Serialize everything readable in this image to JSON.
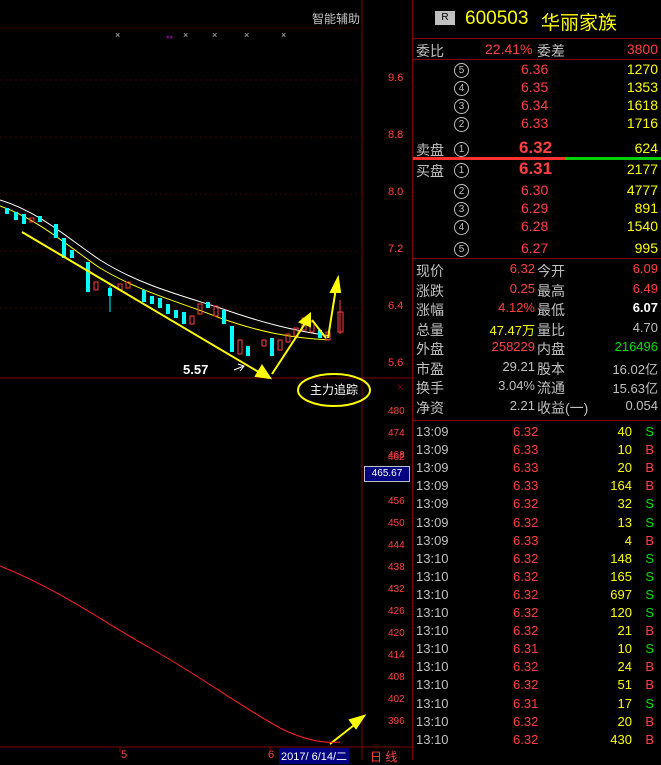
{
  "header": {
    "badge": "R",
    "code": "600503",
    "name": "华丽家族"
  },
  "chart": {
    "assist_label": "智能辅助",
    "right_axis": [
      "9.6",
      "8.8",
      "8.0",
      "7.2",
      "6.4",
      "5.6"
    ],
    "low_marker": "5.57",
    "indicator_label": "主力追踪",
    "indicator_axis": [
      "480",
      "474",
      "468",
      "462",
      "456",
      "450",
      "444",
      "438",
      "432",
      "426",
      "420",
      "414",
      "408",
      "402",
      "396"
    ],
    "indicator_value": "465.67",
    "date_labels": {
      "left": "5",
      "right": "6",
      "current": "2017/ 6/14/二"
    },
    "period_label": "日 线",
    "close_x": "×"
  },
  "order_book": {
    "ratio_label": "委比",
    "ratio_value": "22.41%",
    "diff_label": "委差",
    "diff_value": "3800",
    "sell": [
      {
        "level": "5",
        "price": "6.36",
        "vol": "1270"
      },
      {
        "level": "4",
        "price": "6.35",
        "vol": "1353"
      },
      {
        "level": "3",
        "price": "6.34",
        "vol": "1618"
      },
      {
        "level": "2",
        "price": "6.33",
        "vol": "1716"
      },
      {
        "level": "1",
        "price": "6.32",
        "vol": "624",
        "label": "卖盘"
      }
    ],
    "buy": [
      {
        "level": "1",
        "price": "6.31",
        "vol": "2177",
        "label": "买盘"
      },
      {
        "level": "2",
        "price": "6.30",
        "vol": "4777"
      },
      {
        "level": "3",
        "price": "6.29",
        "vol": "891"
      },
      {
        "level": "4",
        "price": "6.28",
        "vol": "1540"
      },
      {
        "level": "5",
        "price": "6.27",
        "vol": "995"
      }
    ]
  },
  "quote": {
    "rows": [
      {
        "l1": "现价",
        "v1": "6.32",
        "l2": "今开",
        "v2": "6.09",
        "c1": "red",
        "c2": "red"
      },
      {
        "l1": "涨跌",
        "v1": "0.25",
        "l2": "最高",
        "v2": "6.49",
        "c1": "red",
        "c2": "red"
      },
      {
        "l1": "涨幅",
        "v1": "4.12%",
        "l2": "最低",
        "v2": "6.07",
        "c1": "red",
        "c2": "wht"
      },
      {
        "l1": "总量",
        "v1": "47.47万",
        "l2": "量比",
        "v2": "4.70",
        "c1": "yel",
        "c2": "lbl"
      },
      {
        "l1": "外盘",
        "v1": "258229",
        "l2": "内盘",
        "v2": "216496",
        "c1": "red",
        "c2": "grn"
      },
      {
        "l1": "市盈",
        "v1": "29.21",
        "l2": "股本",
        "v2": "16.02亿",
        "c1": "lbl",
        "c2": "lbl"
      },
      {
        "l1": "换手",
        "v1": "3.04%",
        "l2": "流通",
        "v2": "15.63亿",
        "c1": "lbl",
        "c2": "lbl"
      },
      {
        "l1": "净资",
        "v1": "2.21",
        "l2": "收益(一)",
        "v2": "0.054",
        "c1": "lbl",
        "c2": "lbl"
      }
    ]
  },
  "ticks": [
    {
      "time": "13:09",
      "price": "6.32",
      "vol": "40",
      "side": "S"
    },
    {
      "time": "13:09",
      "price": "6.33",
      "vol": "10",
      "side": "B"
    },
    {
      "time": "13:09",
      "price": "6.33",
      "vol": "20",
      "side": "B"
    },
    {
      "time": "13:09",
      "price": "6.33",
      "vol": "164",
      "side": "B"
    },
    {
      "time": "13:09",
      "price": "6.32",
      "vol": "32",
      "side": "S"
    },
    {
      "time": "13:09",
      "price": "6.32",
      "vol": "13",
      "side": "S"
    },
    {
      "time": "13:09",
      "price": "6.33",
      "vol": "4",
      "side": "B"
    },
    {
      "time": "13:10",
      "price": "6.32",
      "vol": "148",
      "side": "S"
    },
    {
      "time": "13:10",
      "price": "6.32",
      "vol": "165",
      "side": "S"
    },
    {
      "time": "13:10",
      "price": "6.32",
      "vol": "697",
      "side": "S"
    },
    {
      "time": "13:10",
      "price": "6.32",
      "vol": "120",
      "side": "S"
    },
    {
      "time": "13:10",
      "price": "6.32",
      "vol": "21",
      "side": "B"
    },
    {
      "time": "13:10",
      "price": "6.31",
      "vol": "10",
      "side": "S"
    },
    {
      "time": "13:10",
      "price": "6.32",
      "vol": "24",
      "side": "B"
    },
    {
      "time": "13:10",
      "price": "6.32",
      "vol": "51",
      "side": "B"
    },
    {
      "time": "13:10",
      "price": "6.31",
      "vol": "17",
      "side": "S"
    },
    {
      "time": "13:10",
      "price": "6.32",
      "vol": "20",
      "side": "B"
    },
    {
      "time": "13:10",
      "price": "6.32",
      "vol": "430",
      "side": "B"
    }
  ]
}
